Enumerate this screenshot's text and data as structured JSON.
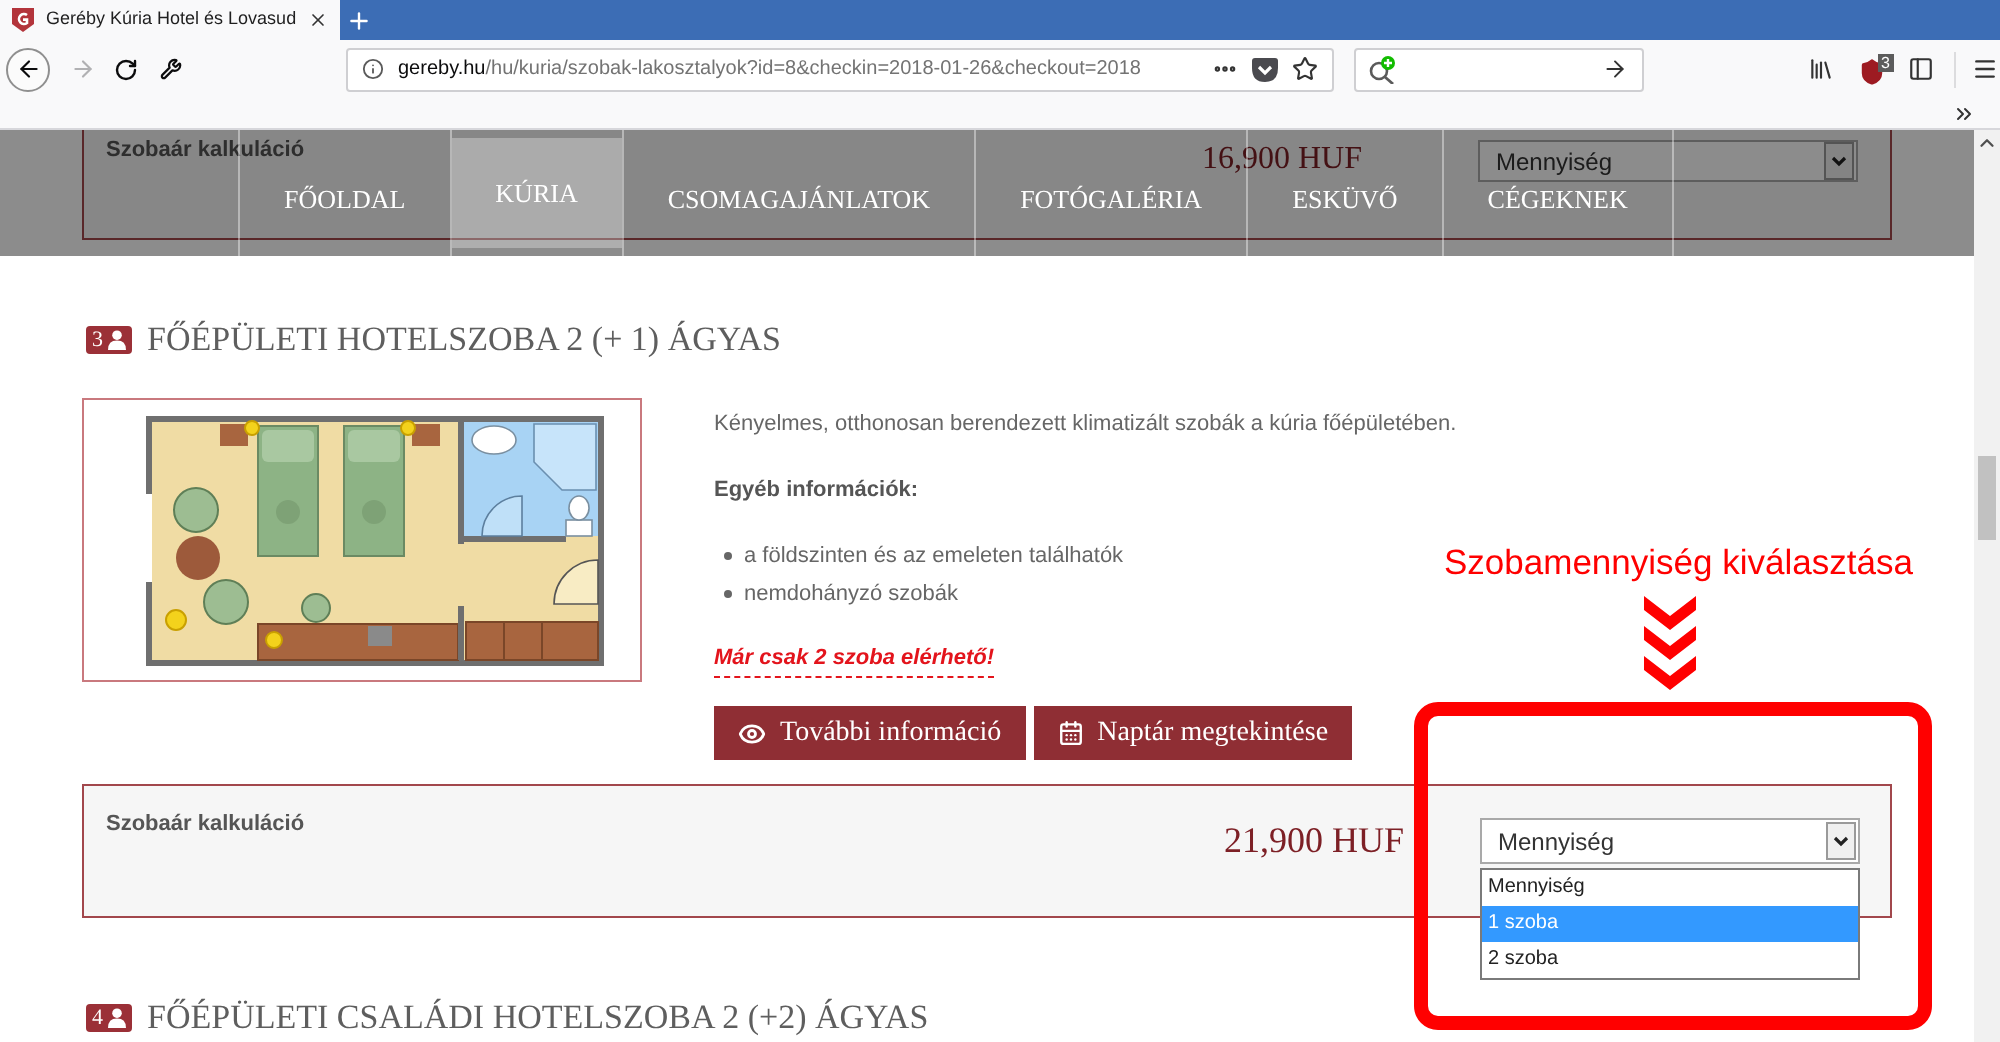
{
  "browser": {
    "tabs": [
      {
        "title": "Geréby Kúria Hotel és Lovasud",
        "selected": true
      }
    ],
    "forward": {
      "disabled": true
    },
    "url": {
      "host": "gereby.hu",
      "path": "/hu/kuria/szobak-lakosztalyok?id=8&checkin=2018-01-26&checkout=2018"
    },
    "extension_badge": "3"
  },
  "nav": {
    "items": [
      {
        "label": "FŐOLDAL",
        "selected": false
      },
      {
        "label": "KÚRIA",
        "selected": true
      },
      {
        "label": "CSOMAGAJÁNLATOK",
        "selected": false
      },
      {
        "label": "FOTÓGALÉRIA",
        "selected": false
      },
      {
        "label": "ESKÜVŐ",
        "selected": false
      },
      {
        "label": "CÉGEKNEK",
        "selected": false
      }
    ]
  },
  "previous_calculation": {
    "label": "Szobaár kalkuláció",
    "price": "16,900 HUF",
    "select": "Mennyiség"
  },
  "rooms": [
    {
      "number": "3",
      "title": "FŐÉPÜLETI HOTELSZOBA 2 (+ 1) ÁGYAS",
      "description": "Kényelmes, otthonosan berendezett klimatizált szobák a kúria főépületében.",
      "info_heading": "Egyéb információk:",
      "features": [
        "a földszinten és az emeleten találhatók",
        "nemdohányzó szobák"
      ],
      "availability": "Már csak 2 szoba elérhető!",
      "buttons": [
        {
          "kind": "info",
          "label": "További információ"
        },
        {
          "kind": "calendar",
          "label": "Naptár megtekintése"
        }
      ],
      "calculation": {
        "label": "Szobaár kalkuláció",
        "price": "21,900 HUF",
        "select": "Mennyiség",
        "expanded": true,
        "options": [
          {
            "label": "Mennyiség",
            "selected": false
          },
          {
            "label": "1 szoba",
            "selected": true
          },
          {
            "label": "2 szoba",
            "selected": false
          }
        ]
      }
    },
    {
      "number": "4",
      "title": "FŐÉPÜLETI CSALÁDI HOTELSZOBA 2 (+2) ÁGYAS"
    }
  ],
  "annotation": {
    "text": "Szobamennyiség kiválasztása"
  }
}
